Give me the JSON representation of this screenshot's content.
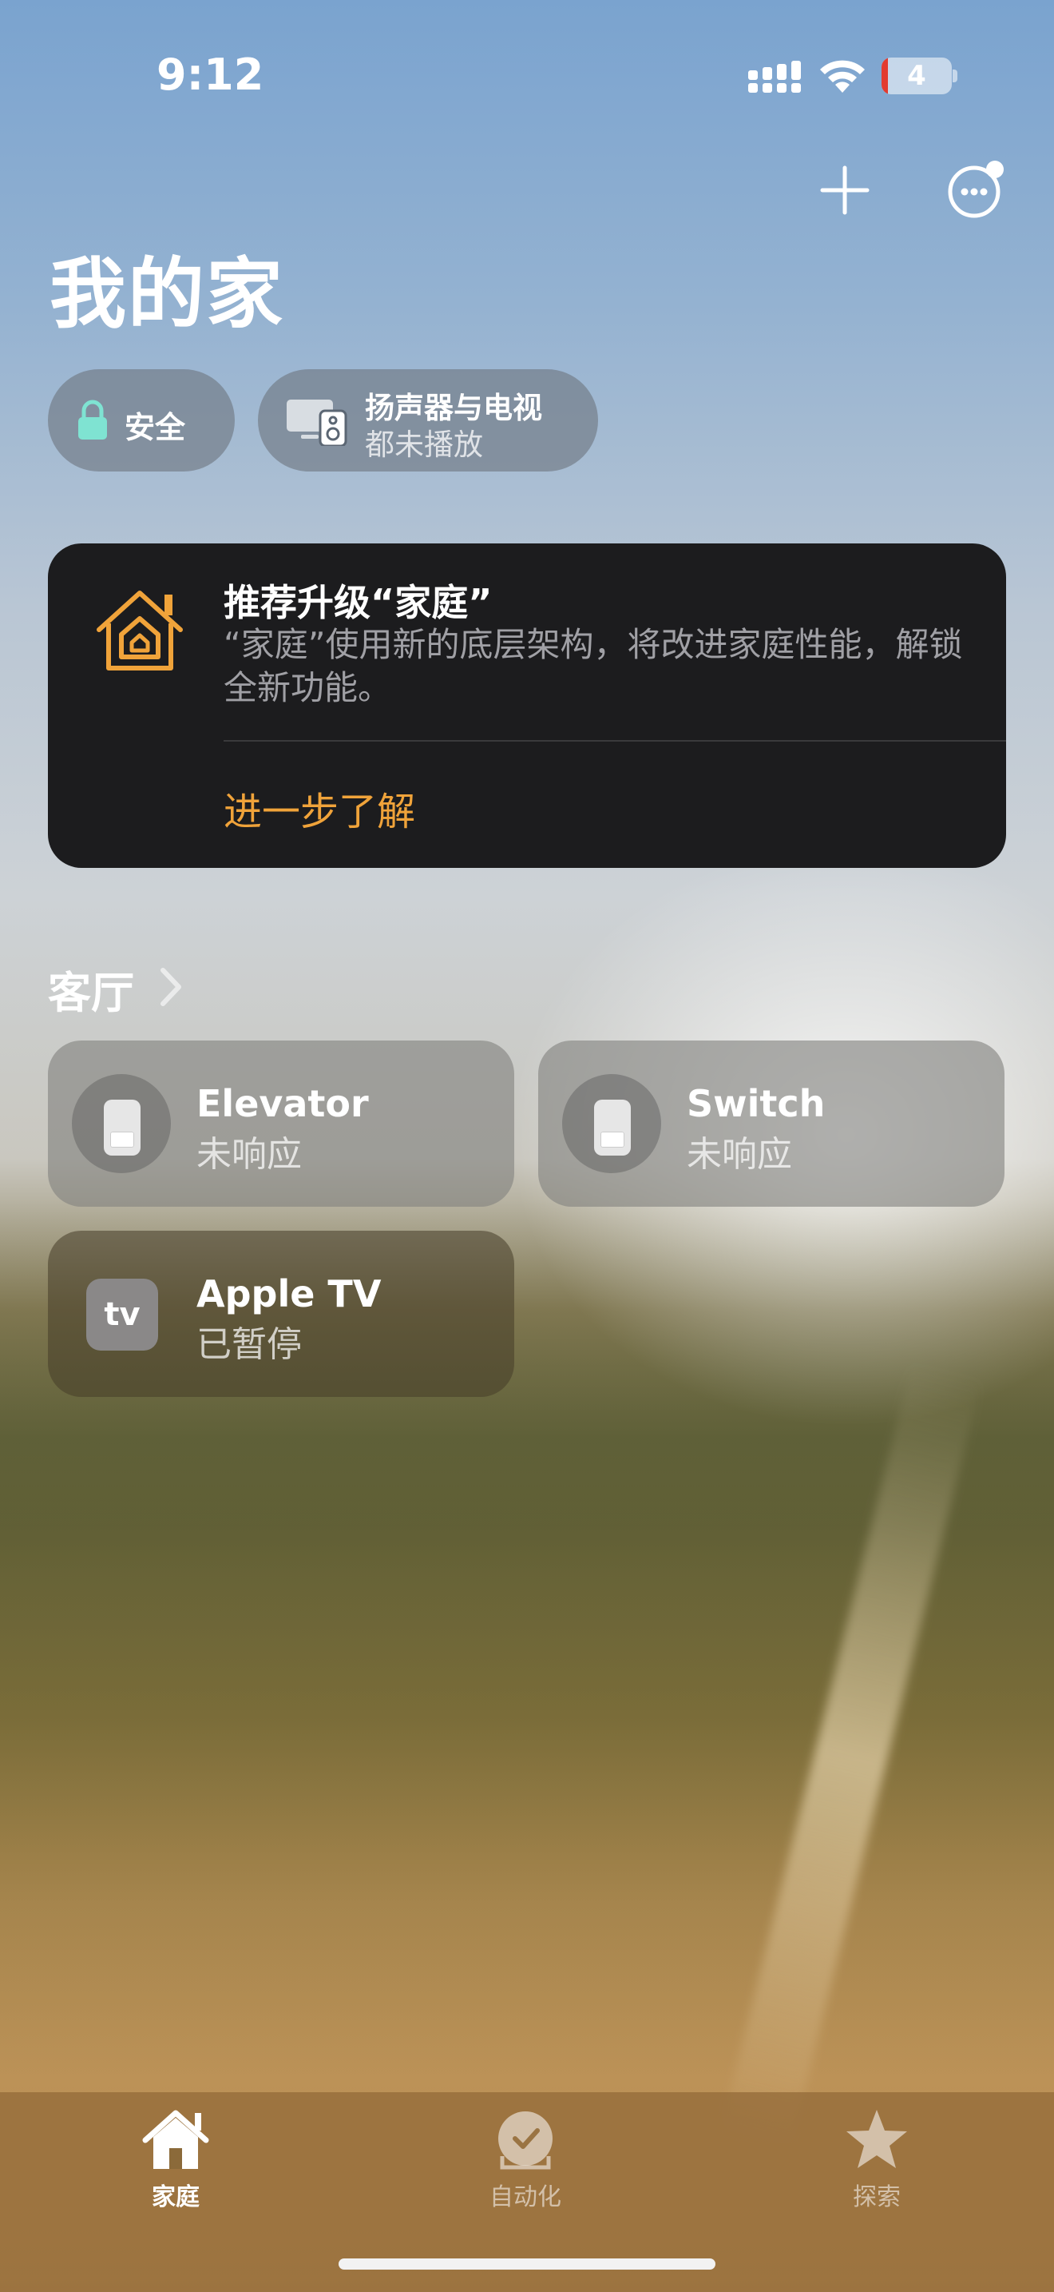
{
  "status_bar": {
    "time": "9:12",
    "battery_level": "4"
  },
  "header": {
    "title": "我的家",
    "add_icon": "plus-icon",
    "more_icon": "ellipsis-circle-icon"
  },
  "chips": {
    "security": {
      "label": "安全",
      "icon": "lock-icon"
    },
    "speakers": {
      "title": "扬声器与电视",
      "subtitle": "都未播放",
      "icon": "speaker-tv-icon"
    }
  },
  "upgrade_card": {
    "title": "推荐升级“家庭”",
    "description": "“家庭”使用新的底层架构，将改进家庭性能，解锁全新功能。",
    "link": "进一步了解",
    "icon": "home-app-icon",
    "accent_color": "#f0a33a"
  },
  "room": {
    "name": "客厅",
    "accessories": [
      {
        "name": "Elevator",
        "status": "未响应",
        "icon": "switch-icon"
      },
      {
        "name": "Switch",
        "status": "未响应",
        "icon": "switch-icon"
      },
      {
        "name": "Apple TV",
        "status": "已暂停",
        "icon": "apple-tv-icon",
        "badge": "tv"
      }
    ]
  },
  "tabs": [
    {
      "label": "家庭",
      "icon": "house-icon",
      "active": true
    },
    {
      "label": "自动化",
      "icon": "clock-check-icon",
      "active": false
    },
    {
      "label": "探索",
      "icon": "star-icon",
      "active": false
    }
  ]
}
